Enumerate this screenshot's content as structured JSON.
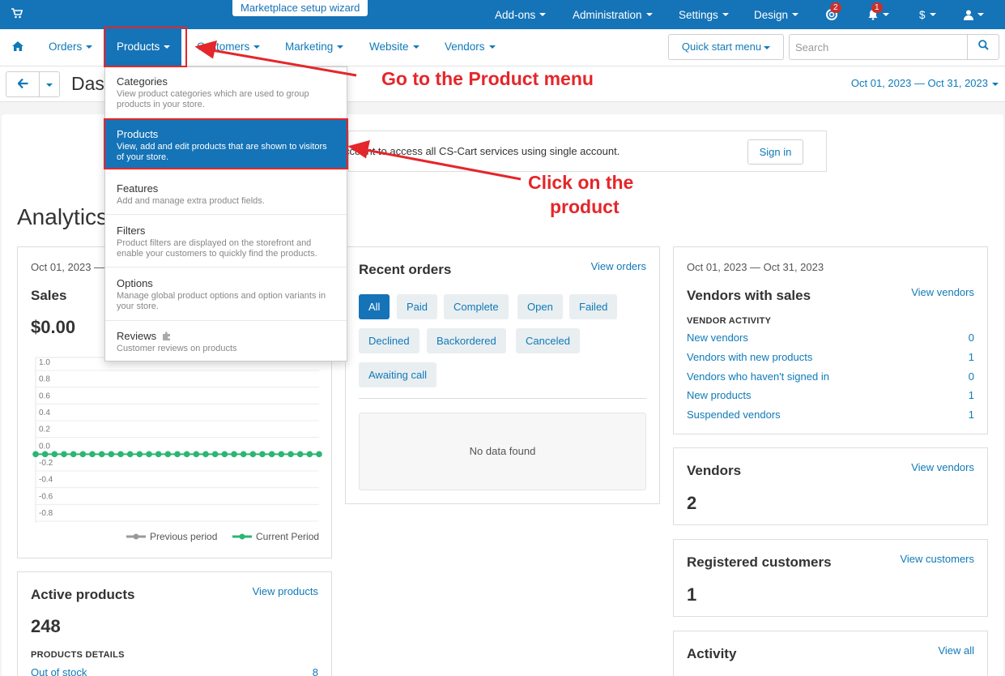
{
  "topbar": {
    "wizard_label": "Marketplace setup wizard",
    "nav": [
      "Add-ons",
      "Administration",
      "Settings",
      "Design"
    ],
    "help_badge": "2",
    "notif_badge": "1",
    "currency": "$"
  },
  "navbar": {
    "items": [
      "Orders",
      "Products",
      "Customers",
      "Marketing",
      "Website",
      "Vendors"
    ],
    "quick_start": "Quick start menu",
    "search_placeholder": "Search"
  },
  "toolbar": {
    "title": "Dashboard",
    "date_range": "Oct 01, 2023 — Oct 31, 2023"
  },
  "notice": {
    "text": "ccount to access all CS-Cart services using single account.",
    "button": "Sign in"
  },
  "analytics_heading": "Analytics",
  "sales": {
    "date": "Oct 01, 2023 —",
    "title": "Sales",
    "amount": "$0.00",
    "legend_prev": "Previous period",
    "legend_curr": "Current Period"
  },
  "chart_data": {
    "type": "line",
    "title": "",
    "ylim": [
      -0.8,
      1.0
    ],
    "yticks": [
      "1.0",
      "0.8",
      "0.6",
      "0.4",
      "0.2",
      "0.0",
      "-0.2",
      "-0.4",
      "-0.6",
      "-0.8"
    ],
    "grid": true,
    "legend_position": "bottom-right",
    "series": [
      {
        "name": "Previous period",
        "color": "#999999",
        "values": []
      },
      {
        "name": "Current Period",
        "color": "#2bb673",
        "values": [
          0,
          0,
          0,
          0,
          0,
          0,
          0,
          0,
          0,
          0,
          0,
          0,
          0,
          0,
          0,
          0,
          0,
          0,
          0,
          0,
          0,
          0,
          0,
          0,
          0,
          0,
          0,
          0,
          0,
          0,
          0
        ]
      }
    ]
  },
  "recent_orders": {
    "title": "Recent orders",
    "view": "View orders",
    "filters": [
      "All",
      "Paid",
      "Complete",
      "Open",
      "Failed",
      "Declined",
      "Backordered",
      "Canceled",
      "Awaiting call"
    ],
    "empty": "No data found"
  },
  "vendors_sales": {
    "date": "Oct 01, 2023 — Oct 31, 2023",
    "title": "Vendors with sales",
    "view": "View vendors",
    "activity_heading": "VENDOR ACTIVITY",
    "rows": [
      {
        "label": "New vendors",
        "value": "0"
      },
      {
        "label": "Vendors with new products",
        "value": "1"
      },
      {
        "label": "Vendors who haven't signed in",
        "value": "0"
      },
      {
        "label": "New products",
        "value": "1"
      },
      {
        "label": "Suspended vendors",
        "value": "1"
      }
    ]
  },
  "vendors": {
    "title": "Vendors",
    "view": "View vendors",
    "count": "2"
  },
  "customers": {
    "title": "Registered customers",
    "view": "View customers",
    "count": "1"
  },
  "activity": {
    "title": "Activity",
    "view": "View all"
  },
  "active_products": {
    "title": "Active products",
    "view": "View products",
    "count": "248",
    "details_heading": "PRODUCTS DETAILS",
    "row_label": "Out of stock",
    "row_value": "8"
  },
  "dropdown": {
    "items": [
      {
        "title": "Categories",
        "desc": "View product categories which are used to group products in your store."
      },
      {
        "title": "Products",
        "desc": "View, add and edit products that are shown to visitors of your store."
      },
      {
        "title": "Features",
        "desc": "Add and manage extra product fields."
      },
      {
        "title": "Filters",
        "desc": "Product filters are displayed on the storefront and enable your customers to quickly find the products."
      },
      {
        "title": "Options",
        "desc": "Manage global product options and option variants in your store."
      },
      {
        "title": "Reviews",
        "desc": "Customer reviews on products"
      }
    ]
  },
  "annotations": {
    "a1": "Go to the Product menu",
    "a2_line1": "Click  on the",
    "a2_line2": "product"
  },
  "colors": {
    "primary": "#1573b7",
    "link": "#0f7ab8",
    "annotation": "#e5262a",
    "current_series": "#2bb673"
  }
}
